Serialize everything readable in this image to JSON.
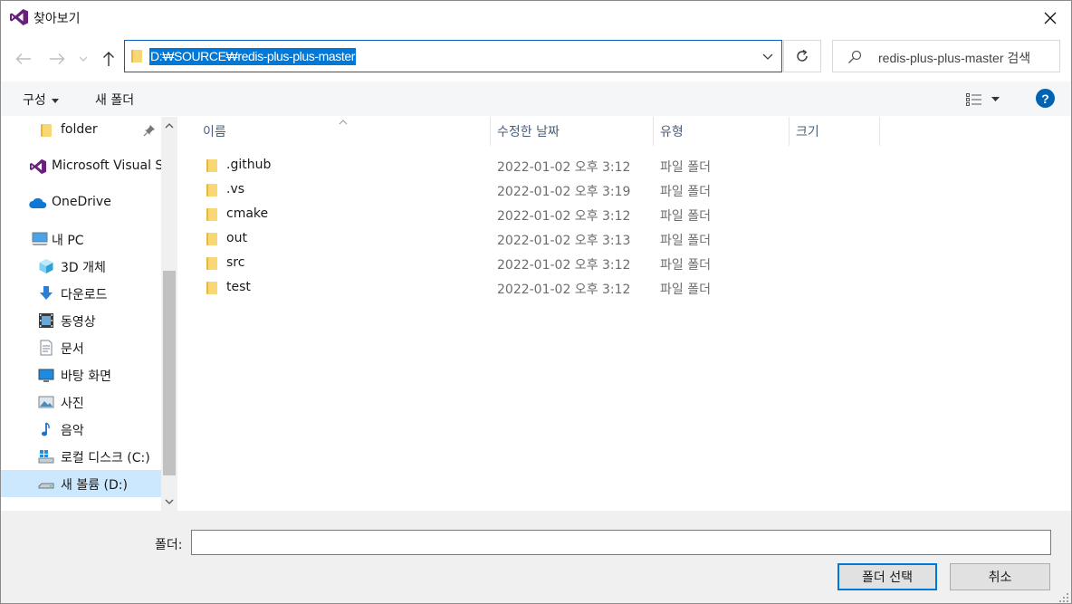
{
  "window": {
    "title": "찾아보기",
    "close_icon": "close-icon"
  },
  "nav": {
    "back_icon": "arrow-left-icon",
    "forward_icon": "arrow-right-icon",
    "recent_icon": "chevron-down-icon",
    "up_icon": "arrow-up-icon",
    "address": "D:₩SOURCE₩redis-plus-plus-master",
    "refresh_icon": "refresh-icon",
    "search_placeholder": "redis-plus-plus-master 검색"
  },
  "toolbar": {
    "organize_label": "구성",
    "new_folder_label": "새 폴더",
    "help_label": "?"
  },
  "sidebar": {
    "items": [
      {
        "label": "folder",
        "icon": "folder-icon",
        "pinned": true
      },
      {
        "label": "Microsoft Visual S",
        "icon": "visual-studio-icon"
      },
      {
        "label": "OneDrive",
        "icon": "onedrive-cloud-icon"
      },
      {
        "label": "내 PC",
        "icon": "pc-icon"
      },
      {
        "label": "3D 개체",
        "icon": "3d-objects-icon"
      },
      {
        "label": "다운로드",
        "icon": "download-icon"
      },
      {
        "label": "동영상",
        "icon": "video-icon"
      },
      {
        "label": "문서",
        "icon": "document-icon"
      },
      {
        "label": "바탕 화면",
        "icon": "desktop-icon"
      },
      {
        "label": "사진",
        "icon": "pictures-icon"
      },
      {
        "label": "음악",
        "icon": "music-icon"
      },
      {
        "label": "로컬 디스크 (C:)",
        "icon": "windows-drive-icon"
      },
      {
        "label": "새 볼륨 (D:)",
        "icon": "drive-icon",
        "selected": true
      }
    ]
  },
  "columns": {
    "name": "이름",
    "modified": "수정한 날짜",
    "type": "유형",
    "size": "크기"
  },
  "files": [
    {
      "name": ".github",
      "modified": "2022-01-02 오후 3:12",
      "type": "파일 폴더"
    },
    {
      "name": ".vs",
      "modified": "2022-01-02 오후 3:19",
      "type": "파일 폴더"
    },
    {
      "name": "cmake",
      "modified": "2022-01-02 오후 3:12",
      "type": "파일 폴더"
    },
    {
      "name": "out",
      "modified": "2022-01-02 오후 3:13",
      "type": "파일 폴더"
    },
    {
      "name": "src",
      "modified": "2022-01-02 오후 3:12",
      "type": "파일 폴더"
    },
    {
      "name": "test",
      "modified": "2022-01-02 오후 3:12",
      "type": "파일 폴더"
    }
  ],
  "footer": {
    "folder_label": "폴더:",
    "folder_value": "",
    "select_button": "폴더 선택",
    "cancel_button": "취소"
  },
  "colors": {
    "accent": "#0078d7",
    "selection": "#cce8ff",
    "folder": "#f8d775"
  }
}
